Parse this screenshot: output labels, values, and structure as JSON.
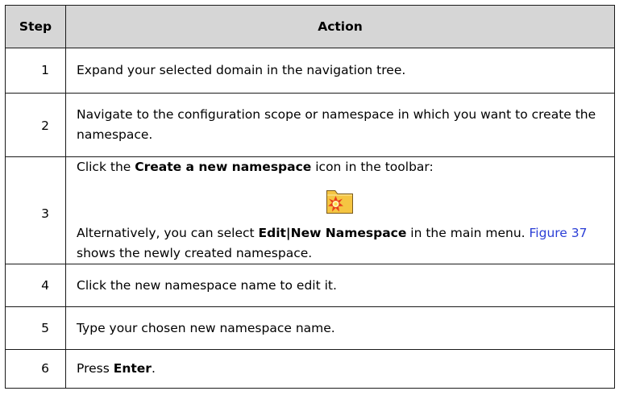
{
  "table": {
    "headers": {
      "step": "Step",
      "action": "Action"
    },
    "rows": [
      {
        "step": "1",
        "text": "Expand your selected domain in the navigation tree."
      },
      {
        "step": "2",
        "text": "Navigate to the configuration scope or namespace in which you want to create the namespace."
      },
      {
        "step": "3",
        "line1_pre": "Click the ",
        "line1_bold": "Create a new namespace",
        "line1_post": " icon in the toolbar:",
        "icon": "new-namespace-folder-icon",
        "line2_pre": "Alternatively, you can select ",
        "line2_bold": "Edit|New Namespace",
        "line2_mid": " in the main menu. ",
        "line2_link": "Figure 37",
        "line2_post": " shows the newly created namespace."
      },
      {
        "step": "4",
        "text": "Click the new namespace name to edit it."
      },
      {
        "step": "5",
        "text": "Type your chosen new namespace name."
      },
      {
        "step": "6",
        "pre": "Press ",
        "bold": "Enter",
        "post": "."
      }
    ]
  },
  "colors": {
    "header_bg": "#d6d6d6",
    "border": "#1a1a1a",
    "link": "#2b3fd6",
    "folder": "#f5c542"
  }
}
